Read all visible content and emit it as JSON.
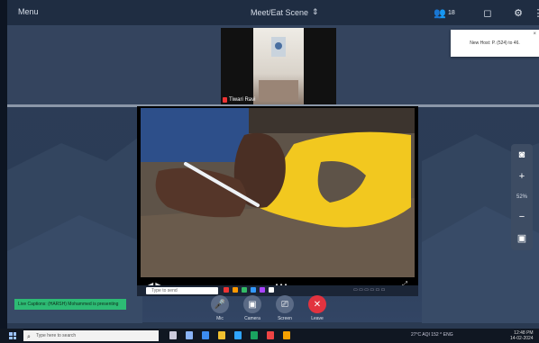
{
  "topbar": {
    "menu_label": "Menu",
    "meeting_title": "Meet/Eat Scene",
    "participants_count": "18",
    "icons": [
      "participants-icon",
      "share-icon",
      "settings-icon",
      "more-icon"
    ]
  },
  "thumbnail": {
    "name": "Tiwari Ravi"
  },
  "toast": {
    "text": "New Host: P. (524) to 46."
  },
  "right_toolbar": {
    "zoom": "52%"
  },
  "video_controls": {
    "left": "◀ ▶",
    "center": "• • •",
    "right": "⤢"
  },
  "chat": {
    "placeholder": "Type to send"
  },
  "status_bar": {
    "text": "Live Captions: (HARSH) Mohammed is presenting"
  },
  "controls": [
    {
      "label": "Mic",
      "icon": "mic-icon"
    },
    {
      "label": "Camera",
      "icon": "camera-icon"
    },
    {
      "label": "Screen",
      "icon": "screen-share-icon"
    },
    {
      "label": "Leave",
      "icon": "leave-icon"
    }
  ],
  "taskbar": {
    "search_placeholder": "Type here to search",
    "tray_text": "27°C  AQI 152  ^  ENG",
    "time": "12:48 PM",
    "date": "14-02-2024"
  },
  "colors": {
    "leave": "#e2333f",
    "status": "#2dbb74",
    "highlight_paper": "#f2c81f"
  }
}
